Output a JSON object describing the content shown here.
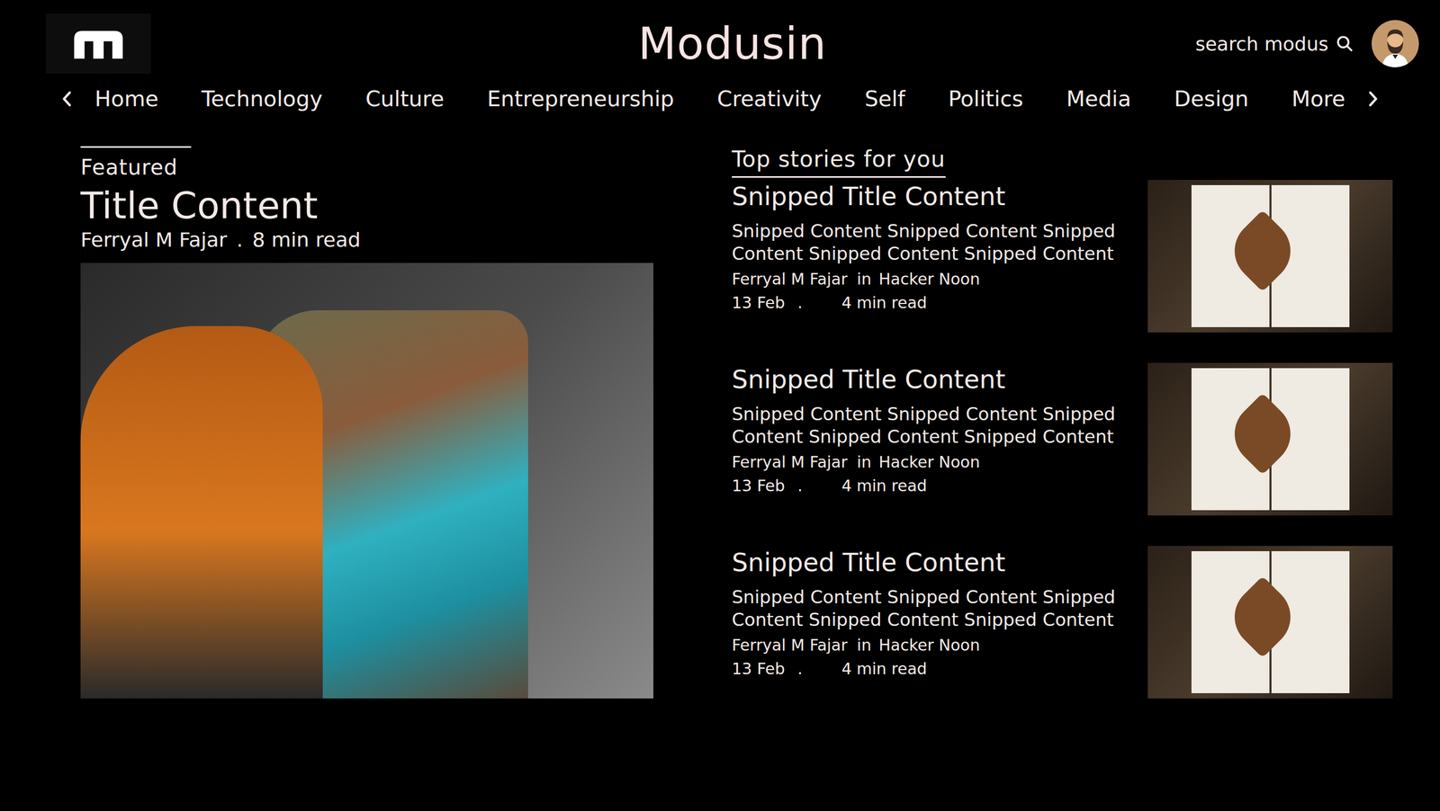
{
  "header": {
    "brand": "Modusin",
    "search": {
      "placeholder": "search modus"
    }
  },
  "nav": {
    "items": [
      "Home",
      "Technology",
      "Culture",
      "Entrepreneurship",
      "Creativity",
      "Self",
      "Politics",
      "Media",
      "Design",
      "More"
    ]
  },
  "featured": {
    "label": "Featured",
    "title": "Title Content",
    "author": "Ferryal M Fajar",
    "separator": ".",
    "read_time": "8 min read"
  },
  "top_stories": {
    "heading": "Top stories for you",
    "stories": [
      {
        "title": "Snipped Title Content",
        "snippet": "Snipped Content Snipped Content Snipped Content Snipped Content Snipped Content",
        "author": "Ferryal M Fajar",
        "source_prefix": "in",
        "source": "Hacker Noon",
        "date": "13 Feb",
        "separator": ".",
        "read_time": "4 min read"
      },
      {
        "title": "Snipped Title Content",
        "snippet": "Snipped Content Snipped Content Snipped Content Snipped Content Snipped Content",
        "author": "Ferryal M Fajar",
        "source_prefix": "in",
        "source": "Hacker Noon",
        "date": "13 Feb",
        "separator": ".",
        "read_time": "4 min read"
      },
      {
        "title": "Snipped Title Content",
        "snippet": "Snipped Content Snipped Content Snipped Content Snipped Content Snipped Content",
        "author": "Ferryal M Fajar",
        "source_prefix": "in",
        "source": "Hacker Noon",
        "date": "13 Feb",
        "separator": ".",
        "read_time": "4 min read"
      }
    ]
  }
}
